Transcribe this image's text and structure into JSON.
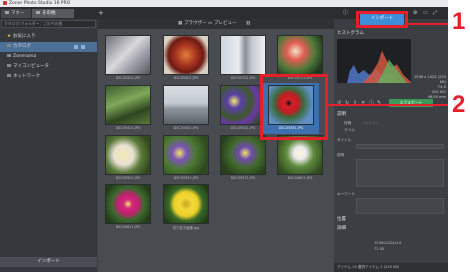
{
  "window": {
    "title": "Zoner Photo Studio 16 PRO"
  },
  "tabs": [
    {
      "label": "マネージャー"
    },
    {
      "label": "その他"
    }
  ],
  "header": {
    "import_button": "インポート"
  },
  "annotations": {
    "n1": "1",
    "n2": "2"
  },
  "sidebar": {
    "path": "カタログ/フォルダー：このその他",
    "items": [
      {
        "label": "お気に入り"
      },
      {
        "label": "カタログ"
      },
      {
        "label": "Zonerama"
      },
      {
        "label": "マイコンピュータ"
      },
      {
        "label": "ネットワーク"
      }
    ],
    "import_label": "インポート"
  },
  "browser_bar": {
    "browser_label": "ブラウザー",
    "preview_label": "プレビュー"
  },
  "thumbnails": [
    {
      "caption": "DSC05201.JPG"
    },
    {
      "caption": "DSC05401.JPG"
    },
    {
      "caption": "DSC05701.JPG"
    },
    {
      "caption": "DSC05721.JPG"
    },
    {
      "caption": "DSC05411.JPG"
    },
    {
      "caption": "DSC05501.JPG"
    },
    {
      "caption": "DSC05521.JPG"
    },
    {
      "caption": "DSC05551.JPG"
    },
    {
      "caption": "DSC05501.JPG"
    },
    {
      "caption": "DSC05551.JPG"
    },
    {
      "caption": "DSC05571.JPG"
    },
    {
      "caption": "DSC05621.JPG"
    },
    {
      "caption": "DSC05611.JPG"
    },
    {
      "caption": "切り抜き画像.jpg"
    }
  ],
  "right_panel": {
    "histogram_label": "ヒストグラム",
    "info": [
      "1536 x 1024 (225 KB)",
      "F4.0",
      "200 ISO",
      "46.00 mm"
    ],
    "edit_button": "エクスポート",
    "sections": {
      "info": "説明",
      "rating": "評価",
      "label": "ラベル",
      "title": "タイトル",
      "description": "説明",
      "keywords": "キーワード",
      "location": "位置",
      "details": "詳細"
    },
    "details": [
      "1536x1024x24",
      "72.00"
    ]
  },
  "status": {
    "text": "アイテム 14   選択アイテム 1 (225 KB)"
  },
  "colors": {
    "accent": "#3c8ed8",
    "annotation": "#e5202a",
    "selection": "#3e6fae"
  }
}
